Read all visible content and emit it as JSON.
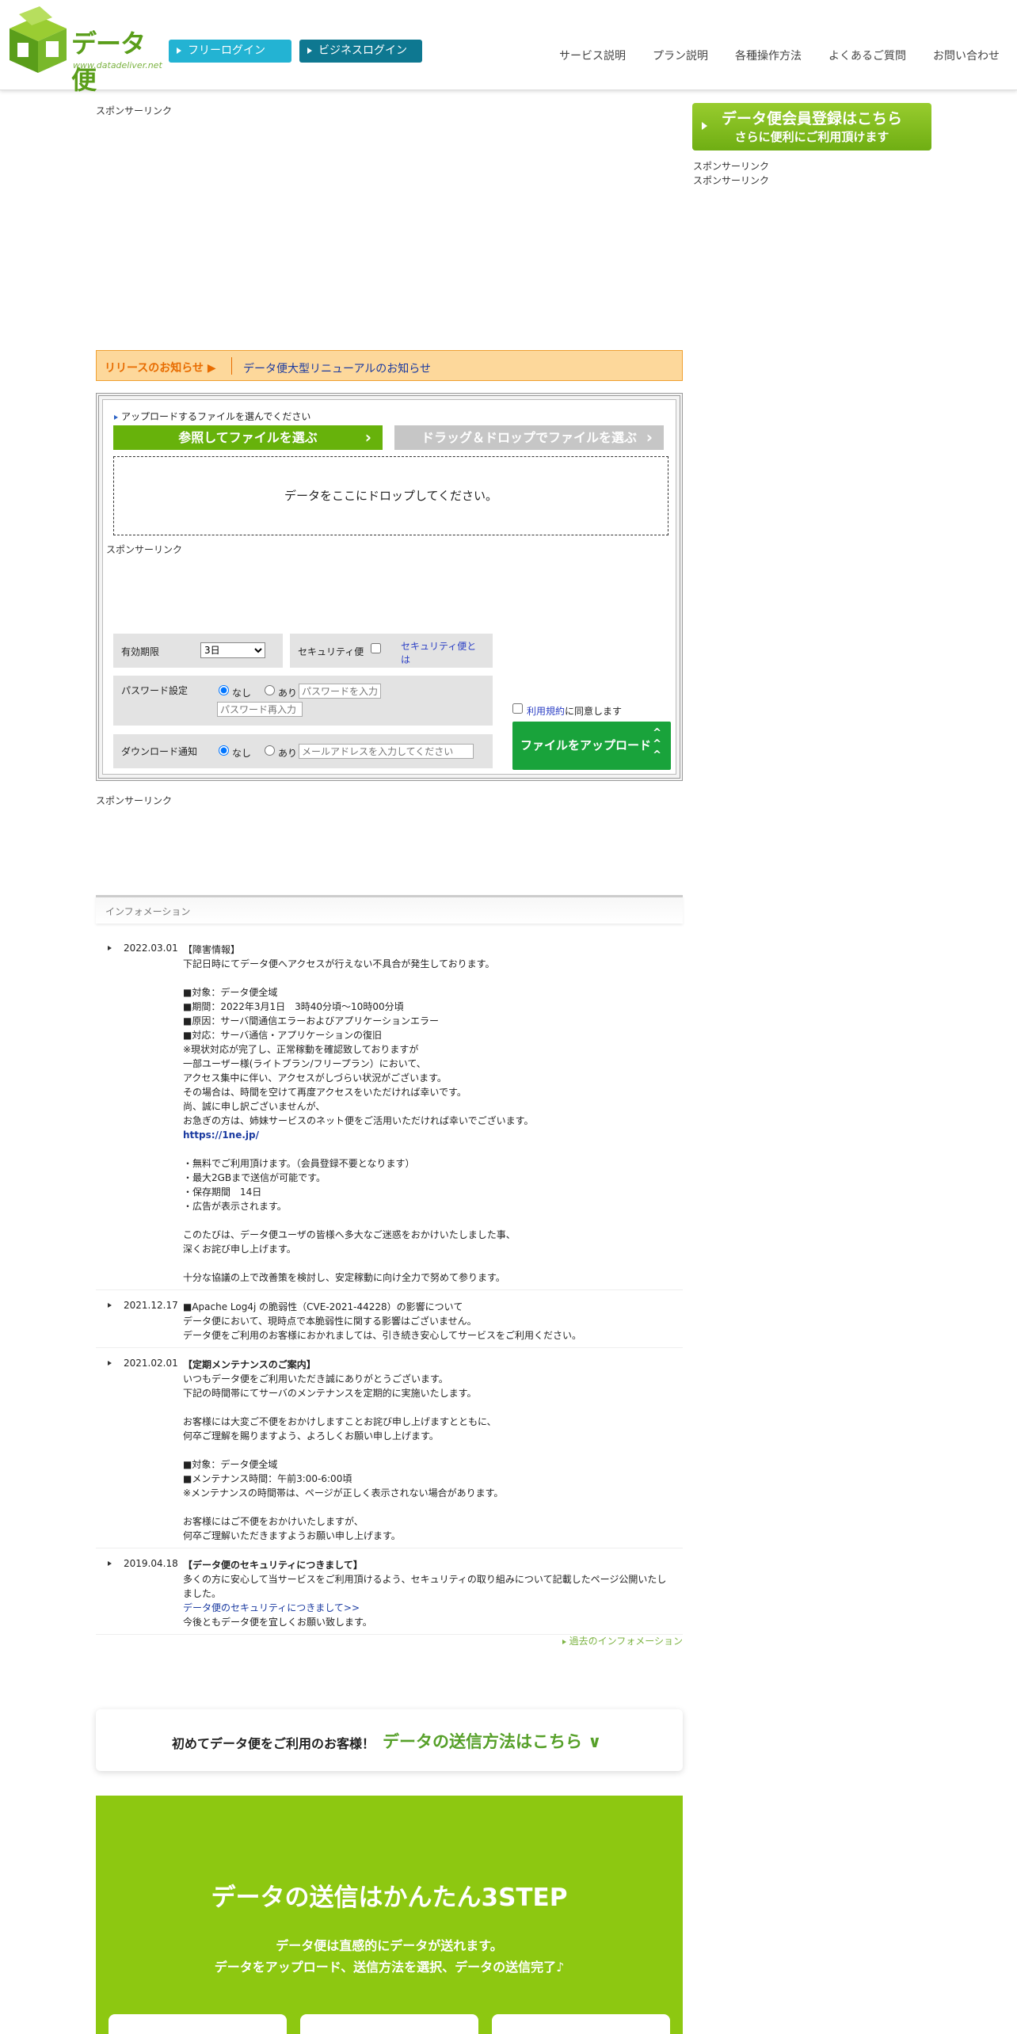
{
  "header": {
    "logo_text": "データ便",
    "logo_url": "www.datadeliver.net",
    "free_login": "フリーログイン",
    "business_login": "ビジネスログイン",
    "nav": [
      "サービス説明",
      "プラン説明",
      "各種操作方法",
      "よくあるご質問",
      "お問い合わせ"
    ]
  },
  "sponsor_label": "スポンサーリンク",
  "member_banner": {
    "line1": "データ便会員登録はこちら",
    "line2": "さらに便利にご利用頂けます"
  },
  "release": {
    "label": "リリースのお知らせ ▶",
    "link": "データ便大型リニューアルのお知らせ"
  },
  "upload": {
    "title": "アップロードするファイルを選んでください",
    "browse_button": "参照してファイルを選ぶ",
    "dnd_button": "ドラッグ＆ドロップでファイルを選ぶ",
    "drop_text": "データをここにドロップしてください。",
    "expiry_label": "有効期限",
    "expiry_value": "3日",
    "security_label": "セキュリティ便",
    "security_link": "セキュリティ便とは",
    "password_label": "パスワード設定",
    "none_label": "なし",
    "yes_label": "あり",
    "password_placeholder": "パスワードを入力",
    "password_confirm_placeholder": "パスワード再入力",
    "download_label": "ダウンロード通知",
    "email_placeholder": "メールアドレスを入力してください",
    "terms_link": "利用規約",
    "terms_suffix": "に同意します",
    "upload_button": "ファイルをアップロード",
    "chevron": "^"
  },
  "info": {
    "title": "インフォメーション",
    "items": [
      {
        "date": "2022.03.01",
        "lines": [
          "【障害情報】",
          "下記日時にてデータ便へアクセスが行えない不具合が発生しております。",
          "",
          "■対象：データ便全域",
          "■期間：2022年3月1日　3時40分頃～10時00分頃",
          "■原因：サーバ間通信エラーおよびアプリケーションエラー",
          "■対応：サーバ通信・アプリケーションの復旧",
          "※現状対応が完了し、正常稼動を確認致しておりますが",
          "一部ユーザー様(ライトプラン/フリープラン）において、",
          "アクセス集中に伴い、アクセスがしづらい状況がございます。",
          "その場合は、時間を空けて再度アクセスをいただければ幸いです。",
          "尚、誠に申し訳ございませんが、",
          "お急ぎの方は、姉妹サービスのネット便をご活用いただければ幸いでございます。",
          "https://1ne.jp/",
          "",
          "・無料でご利用頂けます。（会員登録不要となります）",
          "・最大2GBまで送信が可能です。",
          "・保存期間　14日",
          "・広告が表示されます。",
          "",
          "このたびは、データ便ユーザの皆様へ多大なご迷惑をおかけいたしました事、",
          "深くお詫び申し上げます。",
          "",
          "十分な協議の上で改善策を検討し、安定稼動に向け全力で努めて参ります。"
        ]
      },
      {
        "date": "2021.12.17",
        "lines": [
          "■Apache Log4j の脆弱性（CVE-2021-44228）の影響について",
          "データ便において、現時点で本脆弱性に関する影響はございません。",
          "データ便をご利用のお客様におかれましては、引き続き安心してサービスをご利用ください。"
        ]
      },
      {
        "date": "2021.02.01",
        "lines": [
          "【定期メンテナンスのご案内】",
          "いつもデータ便をご利用いただき誠にありがとうございます。",
          "下記の時間帯にてサーバのメンテナンスを定期的に実施いたします。",
          "",
          "お客様には大変ご不便をおかけしますことお詫び申し上げますとともに、",
          "何卒ご理解を賜りますよう、よろしくお願い申し上げます。",
          "",
          "■対象：データ便全域",
          "■メンテナンス時間：午前3:00-6:00頃",
          "※メンテナンスの時間帯は、ページが正しく表示されない場合があります。",
          "",
          "お客様にはご不便をおかけいたしますが、",
          "何卒ご理解いただきますようお願い申し上げます。"
        ]
      },
      {
        "date": "2019.04.18",
        "lines": [
          "【データ便のセキュリティにつきまして】",
          "多くの方に安心して当サービスをご利用頂けるよう、セキュリティの取り組みについて記載したページ公開いたしました。",
          "データ便のセキュリティにつきまして>>",
          "今後ともデータ便を宜しくお願い致します。"
        ]
      }
    ],
    "past_link": "過去のインフォメーション"
  },
  "first_time": {
    "question": "初めてデータ便をご利用のお客様！",
    "link": "データの送信方法はこちら ∨"
  },
  "steps": {
    "title": "データの送信はかんたん3STEP",
    "sub1": "データ便は直感的にデータが送れます。",
    "sub2": "データをアップロード、送信方法を選択、データの送信完了♪"
  }
}
